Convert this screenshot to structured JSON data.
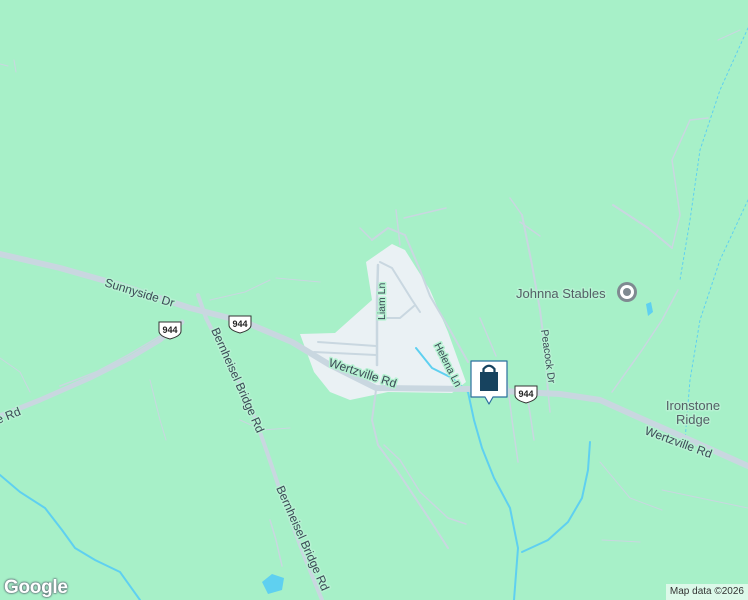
{
  "map": {
    "background_color": "#a7f0c8",
    "road_color": "#c9d7e0",
    "water_color": "#5fd0f0",
    "urban_color": "#eaf1f4"
  },
  "roads": {
    "sunnyside": "Sunnyside Dr",
    "bernheisel_upper": "Bernheisel Bridge Rd",
    "bernheisel_lower": "Bernheisel Bridge Rd",
    "wertzville_west": "Wertzville Rd",
    "wertzville_east": "Wertzville Rd",
    "liam": "Liam Ln",
    "helena": "Helena Ln",
    "peacock": "Peacock Dr",
    "partial_left": "e Rd"
  },
  "route_shields": {
    "west": "944",
    "center": "944",
    "east": "944"
  },
  "places": {
    "johnna_stables": "Johnna Stables",
    "ironstone_line1": "Ironstone",
    "ironstone_line2": "Ridge"
  },
  "icons": {
    "poi": "place-pin-icon",
    "listing": "shopping-bag-icon"
  },
  "branding": {
    "logo": "Google",
    "attribution": "Map data ©2026"
  }
}
